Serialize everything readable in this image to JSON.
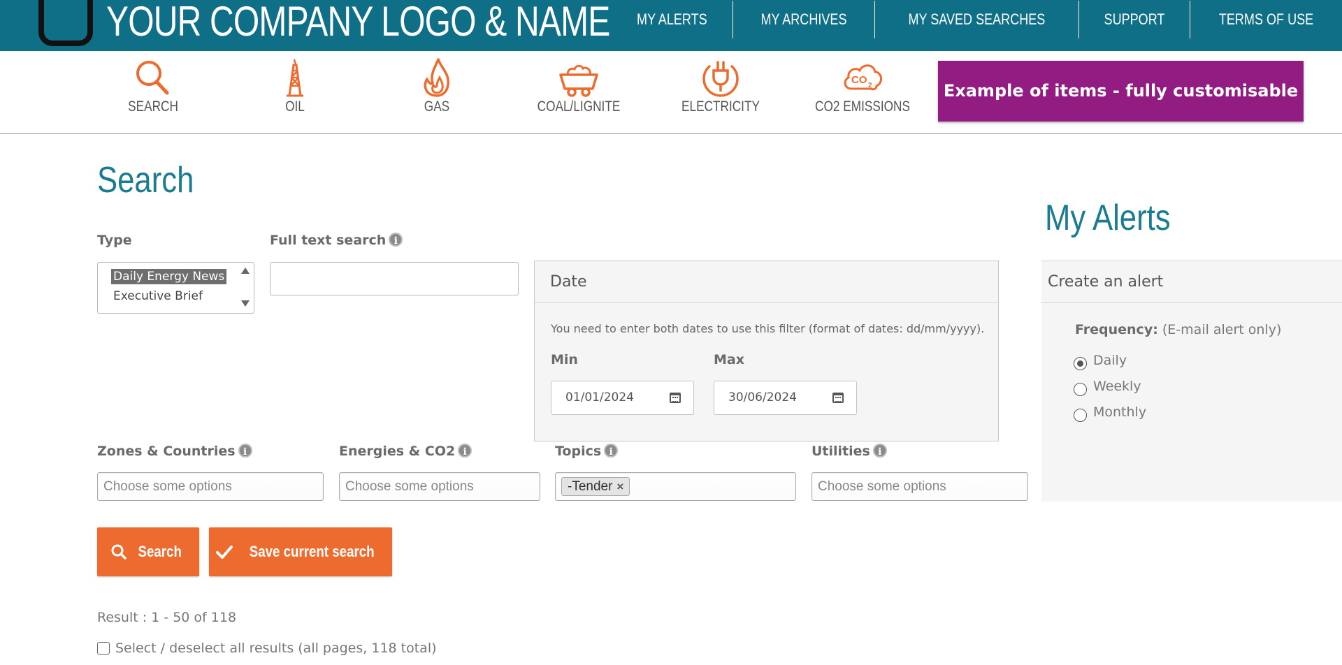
{
  "header": {
    "company_name": "YOUR COMPANY LOGO & NAME",
    "nav": [
      "MY ALERTS",
      "MY ARCHIVES",
      "MY SAVED SEARCHES",
      "SUPPORT",
      "TERMS OF USE"
    ]
  },
  "categories": [
    {
      "label": "SEARCH",
      "icon": "search-icon"
    },
    {
      "label": "OIL",
      "icon": "oil-derrick-icon"
    },
    {
      "label": "GAS",
      "icon": "flame-icon"
    },
    {
      "label": "COAL/LIGNITE",
      "icon": "coal-cart-icon"
    },
    {
      "label": "ELECTRICITY",
      "icon": "plug-icon"
    },
    {
      "label": "CO2 EMISSIONS",
      "icon": "co2-cloud-icon"
    }
  ],
  "promo": "Example of items - fully customisable",
  "colors": {
    "brand": "#0e6f87",
    "accent": "#ed6b2e",
    "promo": "#921c82",
    "heading": "#1b7c90"
  },
  "search": {
    "title": "Search",
    "type_label": "Type",
    "type_options": [
      "Daily Energy News",
      "Executive Brief"
    ],
    "type_selected": "Daily Energy News",
    "fulltext_label": "Full text search",
    "fulltext_value": "",
    "date": {
      "title": "Date",
      "hint": "You need to enter both dates to use this filter (format of dates: dd/mm/yyyy).",
      "min_label": "Min",
      "min_value": "01/01/2024",
      "max_label": "Max",
      "max_value": "30/06/2024"
    },
    "zones_label": "Zones & Countries",
    "energies_label": "Energies & CO2",
    "topics_label": "Topics",
    "utilities_label": "Utilities",
    "placeholder": "Choose some options",
    "topics_chip": "-Tender",
    "search_button": "Search",
    "save_button": "Save current search",
    "result_text": "Result : 1 - 50 of 118",
    "select_all": "Select / deselect all results (all pages, 118 total)"
  },
  "alerts": {
    "title": "My Alerts",
    "panel_title": "Create an alert",
    "frequency_label": "Frequency:",
    "frequency_note": "(E-mail alert only)",
    "options": [
      "Daily",
      "Weekly",
      "Monthly"
    ],
    "selected": "Daily"
  }
}
